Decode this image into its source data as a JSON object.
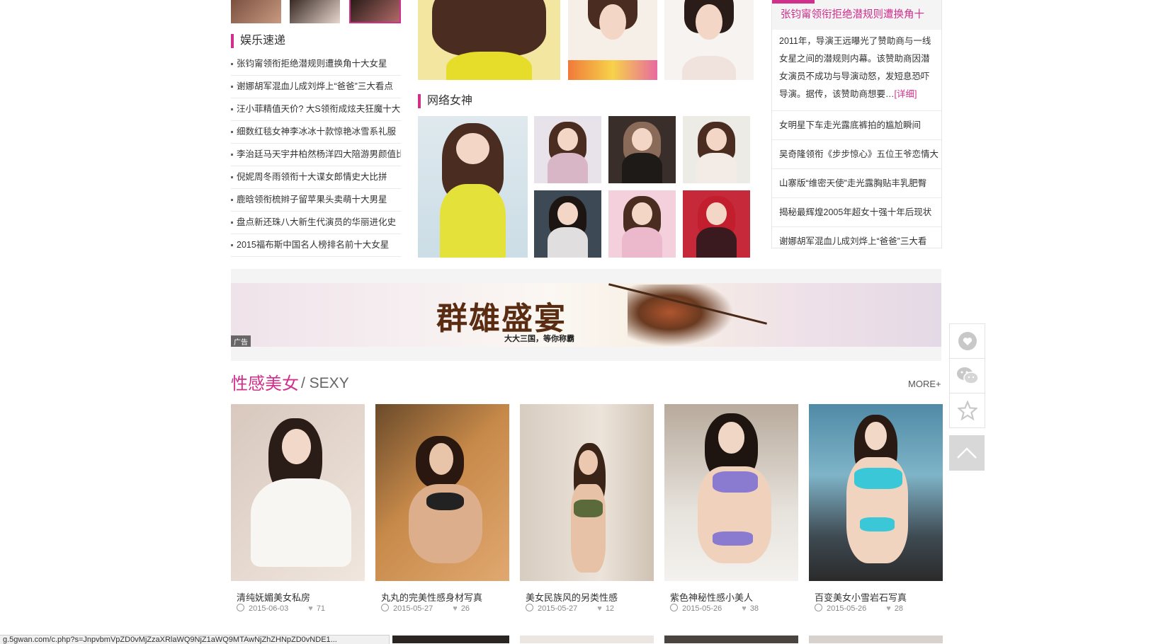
{
  "entertainment": {
    "title": "娱乐速递",
    "items": [
      "张钧甯领衔拒绝潜规则遭换角十大女星",
      "谢娜胡军混血儿成刘烨上“爸爸”三大看点",
      "汪小菲精值天价? 大S领衔成炫夫狂魔十大",
      "细数红毯女神李冰冰十款惊艳冰雪系礼服",
      "李治廷马天宇井柏然杨洋四大陪游男颜值比",
      "倪妮周冬雨领衔十大谍女郎情史大比拼",
      "鹿晗领衔梳辫子留苹果头卖萌十大男星",
      "盘点新还珠八大新生代演员的华丽进化史",
      "2015福布斯中国名人榜排名前十大女星"
    ]
  },
  "internet_goddess": {
    "title": "网络女神"
  },
  "featured": {
    "headline": "张钧甯领衔拒绝潜规则遭换角十",
    "desc": "2011年，导演王远曝光了赞助商与一线女星之间的潜规则内幕。该赞助商因潜女演员不成功与导演动怒，发短息恐吓导演。据传，该赞助商想要…",
    "more": "[详细]",
    "items": [
      "女明星下车走光露底裤拍的尴尬瞬间",
      "吴奇隆领衔《步步惊心》五位王爷恋情大",
      "山寨版“维密天使”走光露胸贴丰乳肥臀",
      "揭秘最辉煌2005年超女十强十年后现状",
      "谢娜胡军混血儿成刘烨上“爸爸”三大看"
    ]
  },
  "banner": {
    "title": "群雄盛宴",
    "subtitle": "大大三国，等你称霸",
    "ad_label": "广告"
  },
  "sexy": {
    "title": "性感美女",
    "title_en": "/ SEXY",
    "more": "MORE+",
    "cards": [
      {
        "caption": "清纯妩媚美女私房",
        "date": "2015-06-03",
        "likes": "71"
      },
      {
        "caption": "丸丸的完美性感身材写真",
        "date": "2015-05-27",
        "likes": "26"
      },
      {
        "caption": "美女民族风的另类性感",
        "date": "2015-05-27",
        "likes": "12"
      },
      {
        "caption": "紫色神秘性感小美人",
        "date": "2015-05-26",
        "likes": "38"
      },
      {
        "caption": "百变美女小雪岩石写真",
        "date": "2015-05-26",
        "likes": "28"
      }
    ]
  },
  "status_bar": {
    "url": "g.5gwan.com/c.php?s=JnpvbmVpZD0vMjZzaXRlaWQ9NjZ1aWQ9MTAwNjZhZHNpZD0vNDE1..."
  },
  "colors": {
    "accent": "#d12f8c",
    "text": "#333333",
    "meta": "#888888"
  },
  "icons": [
    "heart-icon",
    "wechat-icon",
    "favorite-star-icon",
    "back-to-top-icon",
    "clock-icon",
    "like-heart-icon"
  ]
}
